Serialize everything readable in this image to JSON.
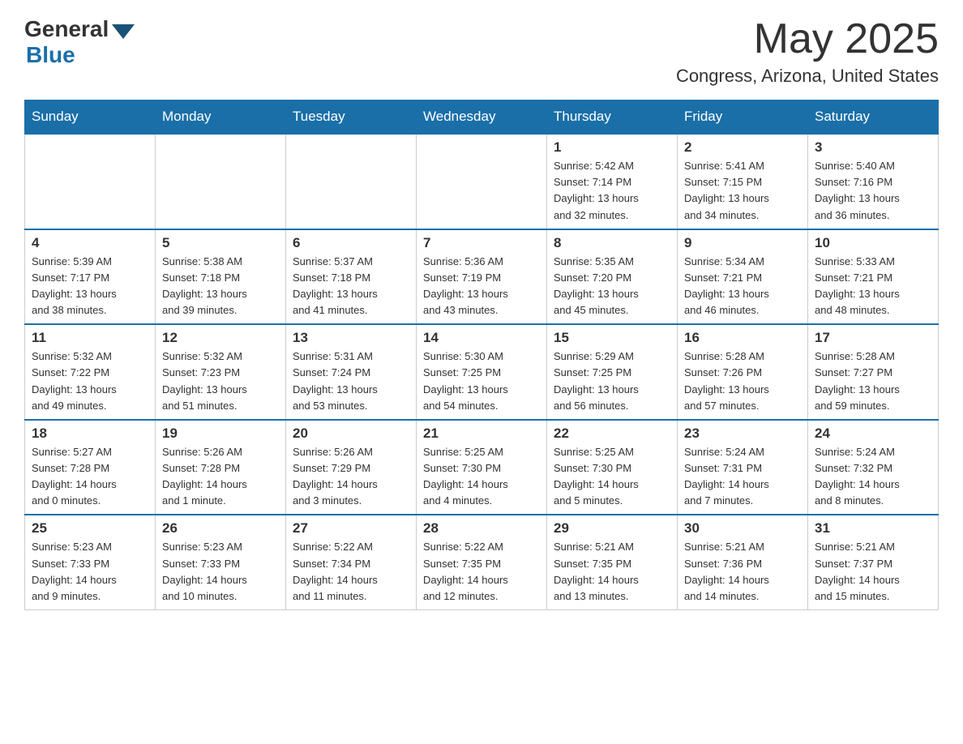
{
  "header": {
    "logo_general": "General",
    "logo_blue": "Blue",
    "month_title": "May 2025",
    "location": "Congress, Arizona, United States"
  },
  "weekdays": [
    "Sunday",
    "Monday",
    "Tuesday",
    "Wednesday",
    "Thursday",
    "Friday",
    "Saturday"
  ],
  "weeks": [
    [
      {
        "day": "",
        "info": ""
      },
      {
        "day": "",
        "info": ""
      },
      {
        "day": "",
        "info": ""
      },
      {
        "day": "",
        "info": ""
      },
      {
        "day": "1",
        "info": "Sunrise: 5:42 AM\nSunset: 7:14 PM\nDaylight: 13 hours\nand 32 minutes."
      },
      {
        "day": "2",
        "info": "Sunrise: 5:41 AM\nSunset: 7:15 PM\nDaylight: 13 hours\nand 34 minutes."
      },
      {
        "day": "3",
        "info": "Sunrise: 5:40 AM\nSunset: 7:16 PM\nDaylight: 13 hours\nand 36 minutes."
      }
    ],
    [
      {
        "day": "4",
        "info": "Sunrise: 5:39 AM\nSunset: 7:17 PM\nDaylight: 13 hours\nand 38 minutes."
      },
      {
        "day": "5",
        "info": "Sunrise: 5:38 AM\nSunset: 7:18 PM\nDaylight: 13 hours\nand 39 minutes."
      },
      {
        "day": "6",
        "info": "Sunrise: 5:37 AM\nSunset: 7:18 PM\nDaylight: 13 hours\nand 41 minutes."
      },
      {
        "day": "7",
        "info": "Sunrise: 5:36 AM\nSunset: 7:19 PM\nDaylight: 13 hours\nand 43 minutes."
      },
      {
        "day": "8",
        "info": "Sunrise: 5:35 AM\nSunset: 7:20 PM\nDaylight: 13 hours\nand 45 minutes."
      },
      {
        "day": "9",
        "info": "Sunrise: 5:34 AM\nSunset: 7:21 PM\nDaylight: 13 hours\nand 46 minutes."
      },
      {
        "day": "10",
        "info": "Sunrise: 5:33 AM\nSunset: 7:21 PM\nDaylight: 13 hours\nand 48 minutes."
      }
    ],
    [
      {
        "day": "11",
        "info": "Sunrise: 5:32 AM\nSunset: 7:22 PM\nDaylight: 13 hours\nand 49 minutes."
      },
      {
        "day": "12",
        "info": "Sunrise: 5:32 AM\nSunset: 7:23 PM\nDaylight: 13 hours\nand 51 minutes."
      },
      {
        "day": "13",
        "info": "Sunrise: 5:31 AM\nSunset: 7:24 PM\nDaylight: 13 hours\nand 53 minutes."
      },
      {
        "day": "14",
        "info": "Sunrise: 5:30 AM\nSunset: 7:25 PM\nDaylight: 13 hours\nand 54 minutes."
      },
      {
        "day": "15",
        "info": "Sunrise: 5:29 AM\nSunset: 7:25 PM\nDaylight: 13 hours\nand 56 minutes."
      },
      {
        "day": "16",
        "info": "Sunrise: 5:28 AM\nSunset: 7:26 PM\nDaylight: 13 hours\nand 57 minutes."
      },
      {
        "day": "17",
        "info": "Sunrise: 5:28 AM\nSunset: 7:27 PM\nDaylight: 13 hours\nand 59 minutes."
      }
    ],
    [
      {
        "day": "18",
        "info": "Sunrise: 5:27 AM\nSunset: 7:28 PM\nDaylight: 14 hours\nand 0 minutes."
      },
      {
        "day": "19",
        "info": "Sunrise: 5:26 AM\nSunset: 7:28 PM\nDaylight: 14 hours\nand 1 minute."
      },
      {
        "day": "20",
        "info": "Sunrise: 5:26 AM\nSunset: 7:29 PM\nDaylight: 14 hours\nand 3 minutes."
      },
      {
        "day": "21",
        "info": "Sunrise: 5:25 AM\nSunset: 7:30 PM\nDaylight: 14 hours\nand 4 minutes."
      },
      {
        "day": "22",
        "info": "Sunrise: 5:25 AM\nSunset: 7:30 PM\nDaylight: 14 hours\nand 5 minutes."
      },
      {
        "day": "23",
        "info": "Sunrise: 5:24 AM\nSunset: 7:31 PM\nDaylight: 14 hours\nand 7 minutes."
      },
      {
        "day": "24",
        "info": "Sunrise: 5:24 AM\nSunset: 7:32 PM\nDaylight: 14 hours\nand 8 minutes."
      }
    ],
    [
      {
        "day": "25",
        "info": "Sunrise: 5:23 AM\nSunset: 7:33 PM\nDaylight: 14 hours\nand 9 minutes."
      },
      {
        "day": "26",
        "info": "Sunrise: 5:23 AM\nSunset: 7:33 PM\nDaylight: 14 hours\nand 10 minutes."
      },
      {
        "day": "27",
        "info": "Sunrise: 5:22 AM\nSunset: 7:34 PM\nDaylight: 14 hours\nand 11 minutes."
      },
      {
        "day": "28",
        "info": "Sunrise: 5:22 AM\nSunset: 7:35 PM\nDaylight: 14 hours\nand 12 minutes."
      },
      {
        "day": "29",
        "info": "Sunrise: 5:21 AM\nSunset: 7:35 PM\nDaylight: 14 hours\nand 13 minutes."
      },
      {
        "day": "30",
        "info": "Sunrise: 5:21 AM\nSunset: 7:36 PM\nDaylight: 14 hours\nand 14 minutes."
      },
      {
        "day": "31",
        "info": "Sunrise: 5:21 AM\nSunset: 7:37 PM\nDaylight: 14 hours\nand 15 minutes."
      }
    ]
  ]
}
